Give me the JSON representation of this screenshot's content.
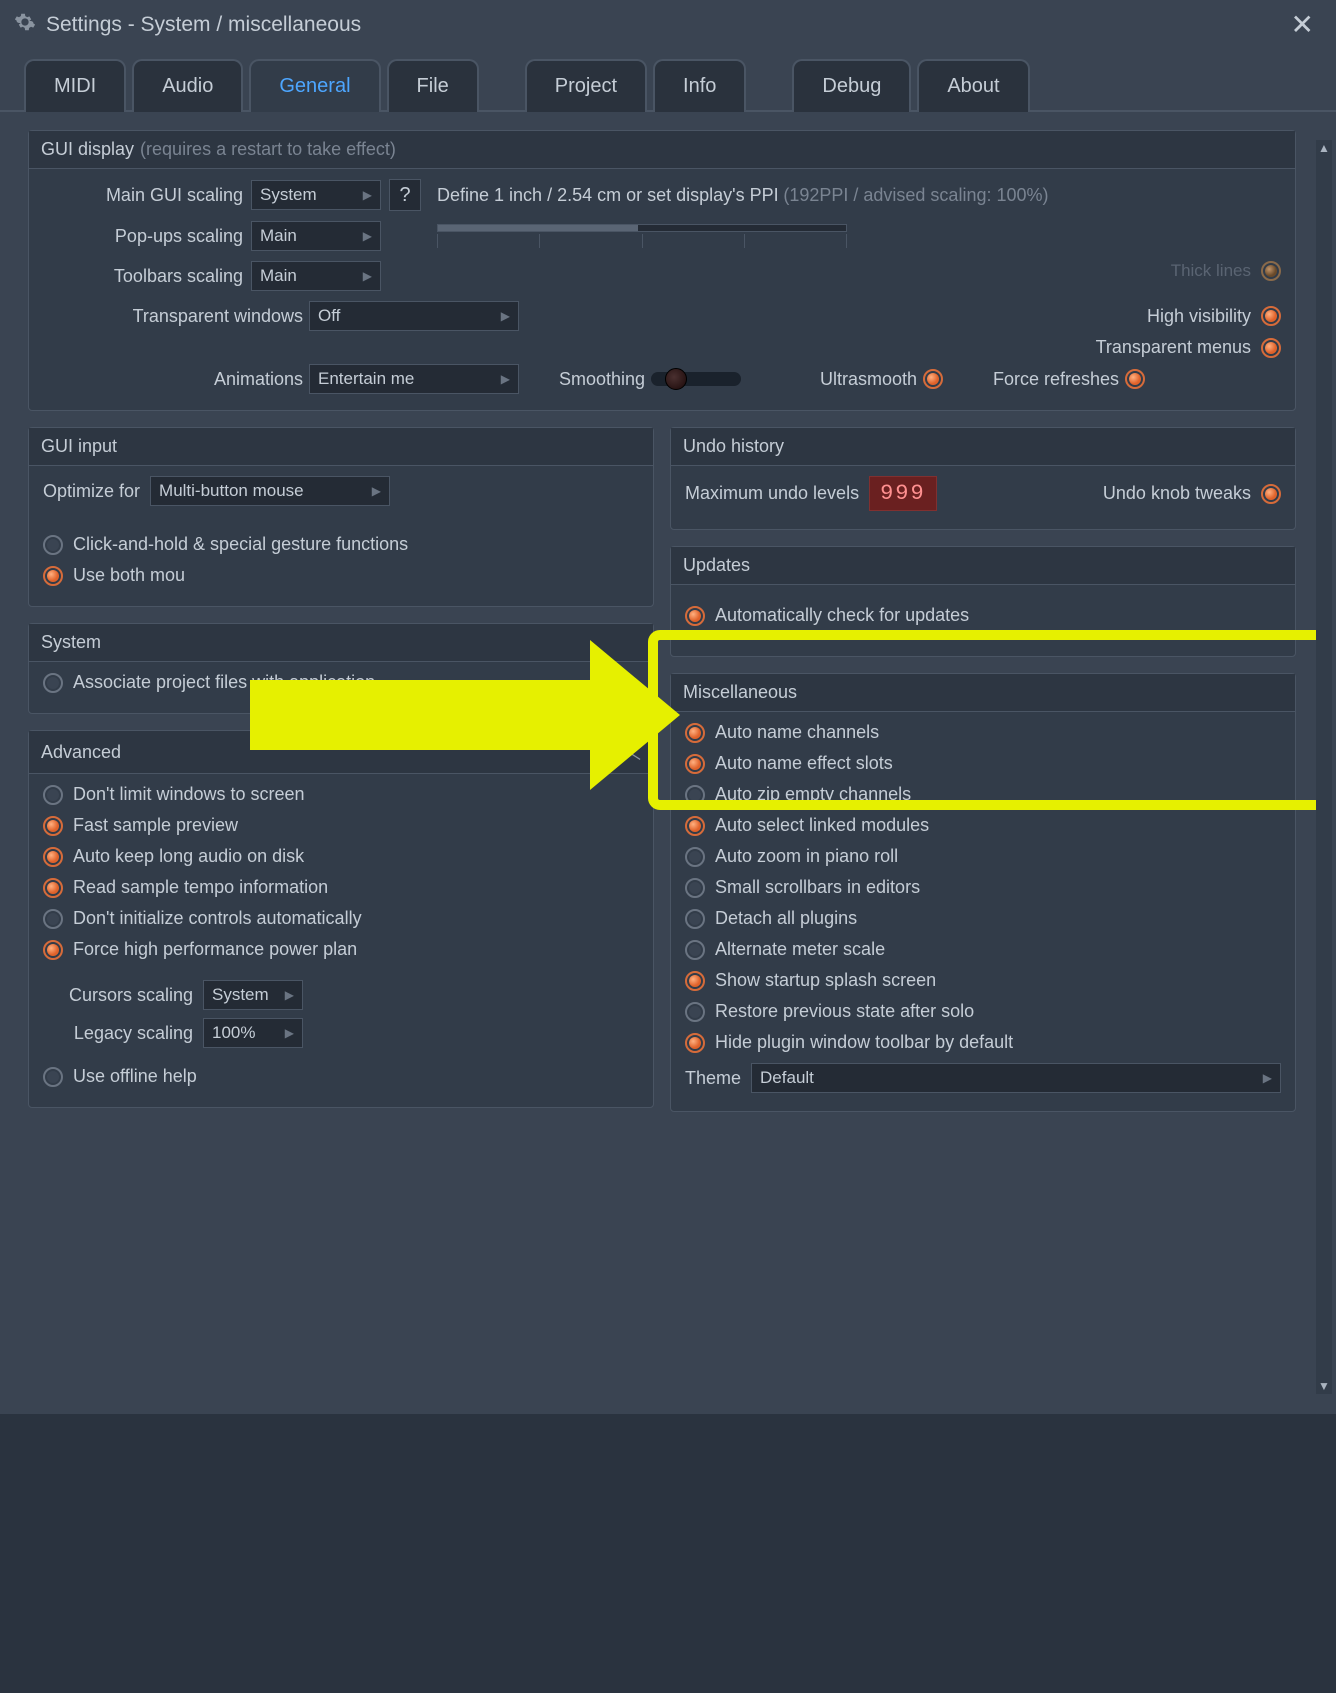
{
  "window": {
    "title": "Settings - System / miscellaneous"
  },
  "tabs": [
    "MIDI",
    "Audio",
    "General",
    "File",
    "Project",
    "Info",
    "Debug",
    "About"
  ],
  "active_tab": "General",
  "gui_display": {
    "title": "GUI display",
    "hint": "(requires a restart to take effect)",
    "main_scaling_label": "Main GUI scaling",
    "main_scaling_value": "System",
    "popup_scaling_label": "Pop-ups scaling",
    "popup_scaling_value": "Main",
    "toolbar_scaling_label": "Toolbars scaling",
    "toolbar_scaling_value": "Main",
    "ppi_text": "Define 1 inch / 2.54 cm or set display's PPI",
    "ppi_hint": "(192PPI / advised scaling: 100%)",
    "transparent_windows_label": "Transparent windows",
    "transparent_windows_value": "Off",
    "animations_label": "Animations",
    "animations_value": "Entertain me",
    "smoothing_label": "Smoothing",
    "ultrasmooth_label": "Ultrasmooth",
    "force_refreshes_label": "Force refreshes",
    "thick_lines_label": "Thick lines",
    "high_visibility_label": "High visibility",
    "transparent_menus_label": "Transparent menus"
  },
  "gui_input": {
    "title": "GUI input",
    "optimize_label": "Optimize for",
    "optimize_value": "Multi-button mouse",
    "click_hold": "Click-and-hold & special gesture functions",
    "use_both": "Use both mou"
  },
  "system": {
    "title": "System",
    "associate": "Associate project files with application"
  },
  "advanced": {
    "title": "Advanced",
    "dont_limit": "Don't limit windows to screen",
    "fast_sample": "Fast sample preview",
    "auto_keep": "Auto keep long audio on disk",
    "read_tempo": "Read sample tempo information",
    "dont_init": "Don't initialize controls automatically",
    "force_power": "Force high performance power plan",
    "cursors_scaling_label": "Cursors scaling",
    "cursors_scaling_value": "System",
    "legacy_scaling_label": "Legacy scaling",
    "legacy_scaling_value": "100%",
    "offline_help": "Use offline help"
  },
  "undo": {
    "title": "Undo history",
    "max_label": "Maximum undo levels",
    "max_value": "999",
    "knob_tweaks": "Undo knob tweaks"
  },
  "updates": {
    "title": "Updates",
    "auto_check": "Automatically check for updates"
  },
  "misc": {
    "title": "Miscellaneous",
    "auto_name_channels": "Auto name channels",
    "auto_name_slots": "Auto name effect slots",
    "auto_zip": "Auto zip empty channels",
    "auto_select_linked": "Auto select linked modules",
    "auto_zoom": "Auto zoom in piano roll",
    "small_scrollbars": "Small scrollbars in editors",
    "detach_plugins": "Detach all plugins",
    "alt_meter": "Alternate meter scale",
    "show_splash": "Show startup splash screen",
    "restore_solo": "Restore previous state after solo",
    "hide_toolbar": "Hide plugin window toolbar by default",
    "theme_label": "Theme",
    "theme_value": "Default"
  }
}
